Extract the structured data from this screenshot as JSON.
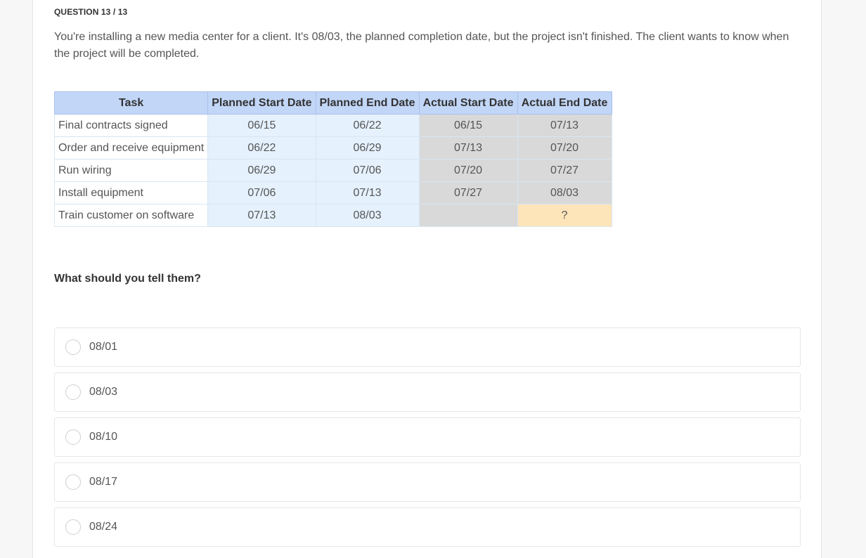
{
  "question": {
    "counter": "QUESTION 13 / 13",
    "prompt": "You're installing a new media center for a client. It's 08/03, the planned completion date, but the project isn't finished. The client wants to know when the project will be completed.",
    "ask": "What should you tell them?"
  },
  "table": {
    "headers": [
      "Task",
      "Planned Start Date",
      "Planned End Date",
      "Actual Start Date",
      "Actual End Date"
    ],
    "rows": [
      [
        "Final contracts signed",
        "06/15",
        "06/22",
        "06/15",
        "07/13"
      ],
      [
        "Order and receive equipment",
        "06/22",
        "06/29",
        "07/13",
        "07/20"
      ],
      [
        "Run wiring",
        "06/29",
        "07/06",
        "07/20",
        "07/27"
      ],
      [
        "Install equipment",
        "07/06",
        "07/13",
        "07/27",
        "08/03"
      ],
      [
        "Train customer on software",
        "07/13",
        "08/03",
        "",
        "?"
      ]
    ]
  },
  "options": [
    "08/01",
    "08/03",
    "08/10",
    "08/17",
    "08/24"
  ],
  "colors": {
    "header_bg": "#c2d6f7",
    "planned_bg": "#e5f1fd",
    "actual_bg": "#d9d9d9",
    "unknown_bg": "#fde4b9"
  }
}
